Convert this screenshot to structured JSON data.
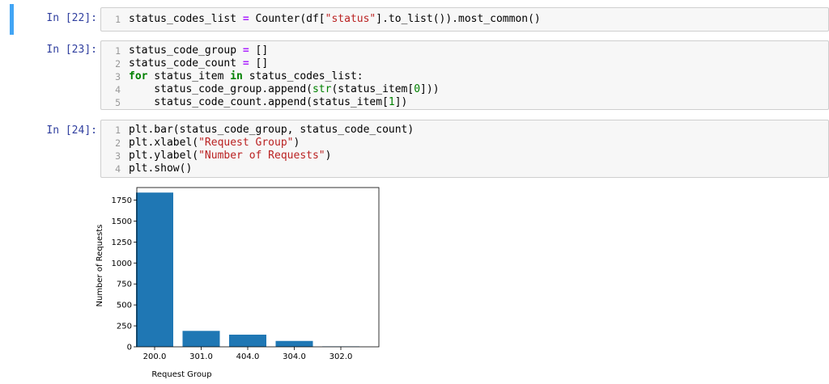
{
  "cells": [
    {
      "prompt": "In [22]:",
      "lines": [
        {
          "n": "1",
          "tokens": [
            {
              "t": "status_codes_list ",
              "c": ""
            },
            {
              "t": "=",
              "c": "tok-op"
            },
            {
              "t": " Counter(df[",
              "c": ""
            },
            {
              "t": "\"status\"",
              "c": "tok-str"
            },
            {
              "t": "].to_list()).most_common()",
              "c": ""
            }
          ]
        }
      ]
    },
    {
      "prompt": "In [23]:",
      "lines": [
        {
          "n": "1",
          "tokens": [
            {
              "t": "status_code_group ",
              "c": ""
            },
            {
              "t": "=",
              "c": "tok-op"
            },
            {
              "t": " []",
              "c": ""
            }
          ]
        },
        {
          "n": "2",
          "tokens": [
            {
              "t": "status_code_count ",
              "c": ""
            },
            {
              "t": "=",
              "c": "tok-op"
            },
            {
              "t": " []",
              "c": ""
            }
          ]
        },
        {
          "n": "3",
          "tokens": [
            {
              "t": "for",
              "c": "tok-kw"
            },
            {
              "t": " status_item ",
              "c": ""
            },
            {
              "t": "in",
              "c": "tok-kw"
            },
            {
              "t": " status_codes_list:",
              "c": ""
            }
          ]
        },
        {
          "n": "4",
          "tokens": [
            {
              "t": "    status_code_group.append(",
              "c": ""
            },
            {
              "t": "str",
              "c": "tok-builtin"
            },
            {
              "t": "(status_item[",
              "c": ""
            },
            {
              "t": "0",
              "c": "tok-num"
            },
            {
              "t": "]))",
              "c": ""
            }
          ]
        },
        {
          "n": "5",
          "tokens": [
            {
              "t": "    status_code_count.append(status_item[",
              "c": ""
            },
            {
              "t": "1",
              "c": "tok-num"
            },
            {
              "t": "])",
              "c": ""
            }
          ]
        }
      ]
    },
    {
      "prompt": "In [24]:",
      "lines": [
        {
          "n": "1",
          "tokens": [
            {
              "t": "plt.bar(status_code_group, status_code_count)",
              "c": ""
            }
          ]
        },
        {
          "n": "2",
          "tokens": [
            {
              "t": "plt.xlabel(",
              "c": ""
            },
            {
              "t": "\"Request Group\"",
              "c": "tok-str"
            },
            {
              "t": ")",
              "c": ""
            }
          ]
        },
        {
          "n": "3",
          "tokens": [
            {
              "t": "plt.ylabel(",
              "c": ""
            },
            {
              "t": "\"Number of Requests\"",
              "c": "tok-str"
            },
            {
              "t": ")",
              "c": ""
            }
          ]
        },
        {
          "n": "4",
          "tokens": [
            {
              "t": "plt.show()",
              "c": ""
            }
          ]
        }
      ]
    }
  ],
  "colors": {
    "selected_bar": "#42a5f5",
    "prompt": "#303f9f",
    "bar_fill": "#1f77b4"
  },
  "chart_data": {
    "type": "bar",
    "categories": [
      "200.0",
      "301.0",
      "404.0",
      "304.0",
      "302.0"
    ],
    "values": [
      1840,
      190,
      145,
      70,
      5
    ],
    "xlabel": "Request Group",
    "ylabel": "Number of Requests",
    "ylim": [
      0,
      1900
    ],
    "yticks": [
      0,
      250,
      500,
      750,
      1000,
      1250,
      1500,
      1750
    ],
    "grid": false,
    "legend": "none"
  }
}
